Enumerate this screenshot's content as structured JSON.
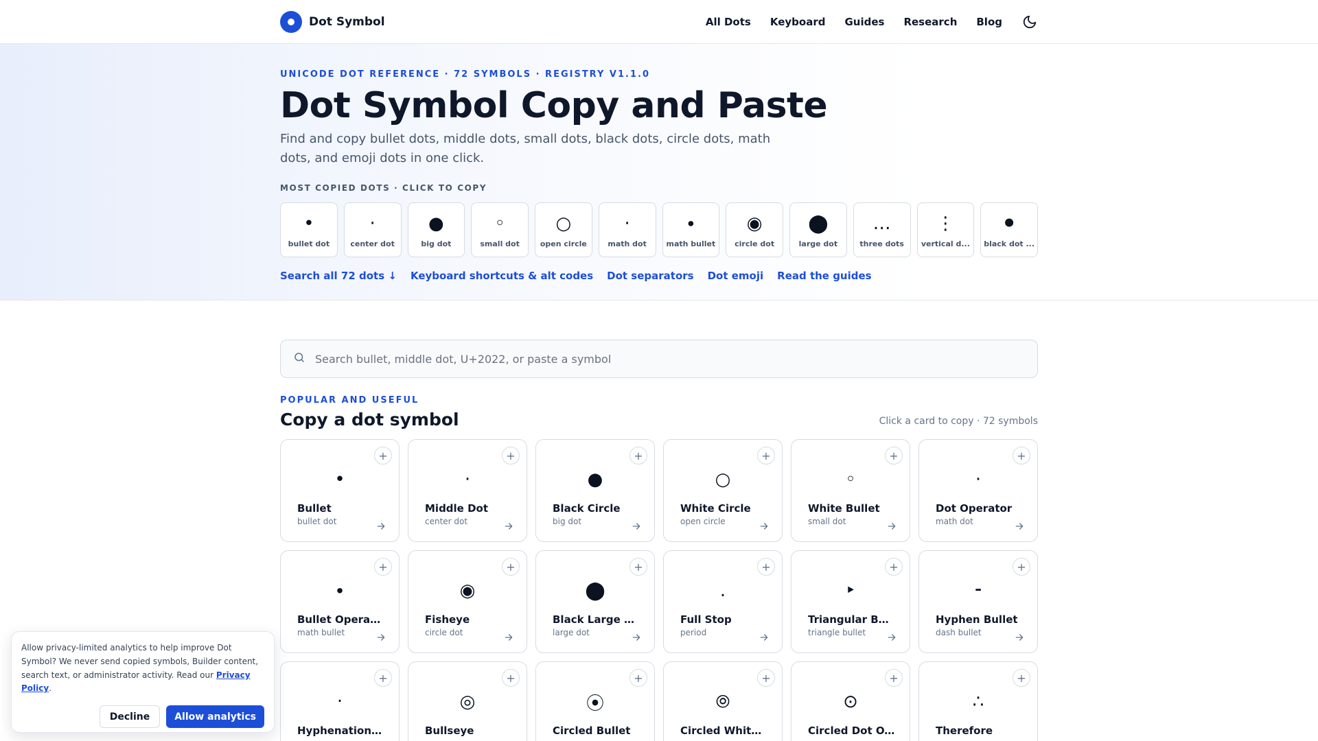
{
  "header": {
    "brand": "Dot Symbol",
    "nav": [
      "All Dots",
      "Keyboard",
      "Guides",
      "Research",
      "Blog"
    ],
    "theme_icon": "moon-icon"
  },
  "hero": {
    "eyebrow": "UNICODE DOT REFERENCE · 72 SYMBOLS · REGISTRY V1.1.0",
    "title": "Dot Symbol Copy and Paste",
    "subtitle": "Find and copy bullet dots, middle dots, small dots, black dots, circle dots, math dots, and emoji dots in one click.",
    "most_copied_label": "MOST COPIED DOTS · CLICK TO COPY",
    "quick": [
      {
        "glyph": "•",
        "label": "bullet dot"
      },
      {
        "glyph": "·",
        "label": "center dot"
      },
      {
        "glyph": "●",
        "label": "big dot"
      },
      {
        "glyph": "◦",
        "label": "small dot"
      },
      {
        "glyph": "○",
        "label": "open circle"
      },
      {
        "glyph": "⋅",
        "label": "math dot"
      },
      {
        "glyph": "∙",
        "label": "math bullet"
      },
      {
        "glyph": "◉",
        "label": "circle dot"
      },
      {
        "glyph": "⬤",
        "label": "large dot"
      },
      {
        "glyph": "…",
        "label": "three dots"
      },
      {
        "glyph": "⋮",
        "label": "vertical d..."
      },
      {
        "glyph": "⚫",
        "label": "black dot ..."
      }
    ],
    "links": [
      "Search all 72 dots ↓",
      "Keyboard shortcuts & alt codes",
      "Dot separators",
      "Dot emoji",
      "Read the guides"
    ]
  },
  "search": {
    "placeholder": "Search bullet, middle dot, U+2022, or paste a symbol",
    "icon": "search-icon"
  },
  "section": {
    "eyebrow": "POPULAR AND USEFUL",
    "title": "Copy a dot symbol",
    "meta": "Click a card to copy · 72 symbols"
  },
  "cards": [
    {
      "glyph": "•",
      "name": "Bullet",
      "sub": "bullet dot"
    },
    {
      "glyph": "·",
      "name": "Middle Dot",
      "sub": "center dot"
    },
    {
      "glyph": "●",
      "name": "Black Circle",
      "sub": "big dot"
    },
    {
      "glyph": "○",
      "name": "White Circle",
      "sub": "open circle"
    },
    {
      "glyph": "◦",
      "name": "White Bullet",
      "sub": "small dot"
    },
    {
      "glyph": "⋅",
      "name": "Dot Operator",
      "sub": "math dot"
    },
    {
      "glyph": "∙",
      "name": "Bullet Operator",
      "sub": "math bullet"
    },
    {
      "glyph": "◉",
      "name": "Fisheye",
      "sub": "circle dot"
    },
    {
      "glyph": "⬤",
      "name": "Black Large C...",
      "sub": "large dot"
    },
    {
      "glyph": ".",
      "name": "Full Stop",
      "sub": "period"
    },
    {
      "glyph": "‣",
      "name": "Triangular Bu...",
      "sub": "triangle bullet"
    },
    {
      "glyph": "⁃",
      "name": "Hyphen Bullet",
      "sub": "dash bullet"
    },
    {
      "glyph": "‧",
      "name": "Hyphenation ...",
      "sub": ""
    },
    {
      "glyph": "◎",
      "name": "Bullseye",
      "sub": ""
    },
    {
      "glyph": "⦿",
      "name": "Circled Bullet",
      "sub": ""
    },
    {
      "glyph": "⦾",
      "name": "Circled White...",
      "sub": ""
    },
    {
      "glyph": "⊙",
      "name": "Circled Dot O...",
      "sub": ""
    },
    {
      "glyph": "∴",
      "name": "Therefore",
      "sub": ""
    }
  ],
  "cookie": {
    "text_before": "Allow privacy-limited analytics to help improve Dot Symbol? We never send copied symbols, Builder content, search text, or administrator activity. Read our ",
    "link": "Privacy Policy",
    "text_after": ".",
    "decline": "Decline",
    "allow": "Allow analytics"
  },
  "colors": {
    "accent": "#1d4ed8",
    "text": "#0f172a",
    "muted": "#64748b",
    "border": "#d6dbe3"
  }
}
